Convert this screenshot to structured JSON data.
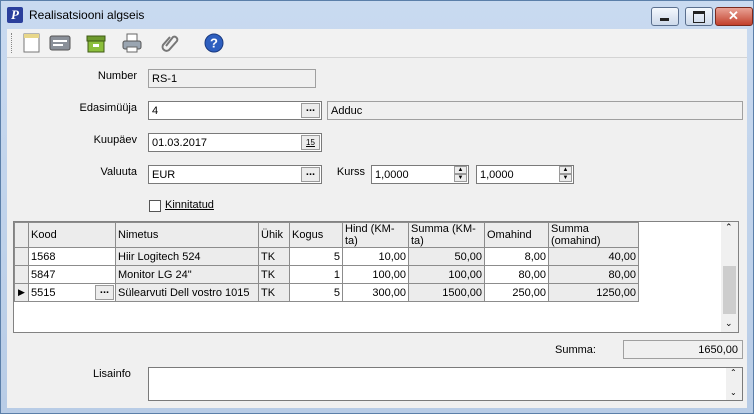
{
  "window": {
    "title": "Realisatsiooni algseis",
    "app_icon_letter": "P"
  },
  "toolbar": {
    "icons": [
      "new-document-icon",
      "card-icon",
      "archive-icon",
      "print-icon",
      "attachment-icon",
      "help-icon"
    ]
  },
  "form": {
    "number_label": "Number",
    "number_value": "RS-1",
    "reseller_label": "Edasimüüja",
    "reseller_code": "4",
    "reseller_name": "Adduc",
    "date_label": "Kuupäev",
    "date_value": "01.03.2017",
    "date_icon_text": "15",
    "currency_label": "Valuuta",
    "currency_value": "EUR",
    "rate_label": "Kurss",
    "rate1": "1,0000",
    "rate2": "1,0000",
    "confirmed_label": "Kinnitatud",
    "lookup_button": "..."
  },
  "table": {
    "headers": [
      "Kood",
      "Nimetus",
      "Ühik",
      "Kogus",
      "Hind (KM-ta)",
      "Summa (KM-ta)",
      "Omahind",
      "Summa (omahind)"
    ],
    "rows": [
      [
        "1568",
        "Hiir Logitech 524",
        "TK",
        "5",
        "10,00",
        "50,00",
        "8,00",
        "40,00"
      ],
      [
        "5847",
        "Monitor LG 24\"",
        "TK",
        "1",
        "100,00",
        "100,00",
        "80,00",
        "80,00"
      ],
      [
        "5515",
        "Sülearvuti Dell vostro 1015",
        "TK",
        "5",
        "300,00",
        "1500,00",
        "250,00",
        "1250,00"
      ]
    ],
    "current_row_marker": "▶"
  },
  "summary": {
    "label": "Summa:",
    "value": "1650,00"
  },
  "notes": {
    "label": "Lisainfo",
    "value": ""
  },
  "colors": {
    "title_bg": "#c9daf0",
    "client_bg": "#f0f0f0",
    "close_btn": "#c2402c"
  }
}
